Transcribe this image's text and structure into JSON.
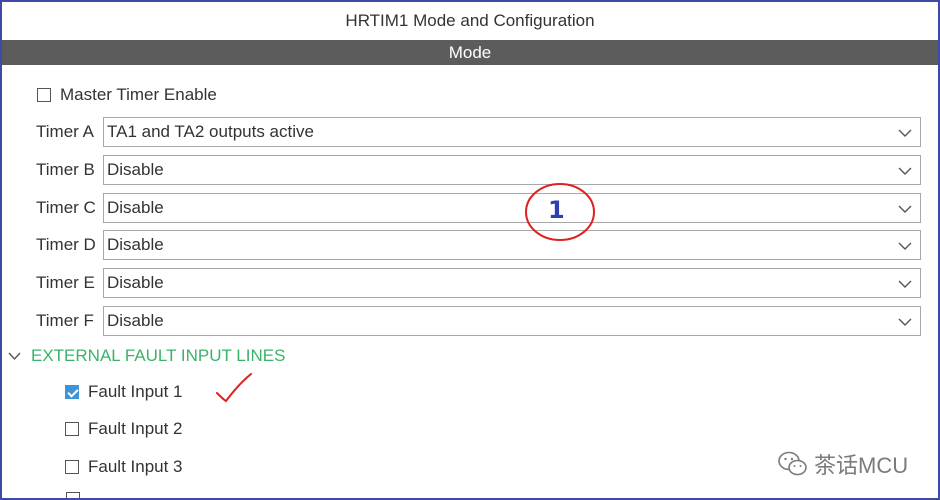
{
  "window": {
    "title": "HRTIM1 Mode and Configuration"
  },
  "mode_bar": {
    "label": "Mode"
  },
  "master_timer": {
    "label": "Master Timer Enable",
    "checked": false
  },
  "timers": [
    {
      "label": "Timer A",
      "value": "TA1 and TA2 outputs active"
    },
    {
      "label": "Timer B",
      "value": "Disable"
    },
    {
      "label": "Timer C",
      "value": "Disable"
    },
    {
      "label": "Timer D",
      "value": "Disable"
    },
    {
      "label": "Timer E",
      "value": "Disable"
    },
    {
      "label": "Timer F",
      "value": "Disable"
    }
  ],
  "section": {
    "label": "EXTERNAL FAULT INPUT LINES",
    "expanded": true,
    "color": "#3ab36a"
  },
  "fault_inputs": [
    {
      "label": "Fault Input 1",
      "checked": true
    },
    {
      "label": "Fault Input 2",
      "checked": false
    },
    {
      "label": "Fault Input 3",
      "checked": false
    }
  ],
  "annotations": {
    "circle_number": "1",
    "circle_color": "#e02020",
    "number_color": "#2f3fb3",
    "tick_color": "#e02020"
  },
  "watermark": {
    "text": "茶话MCU",
    "icon": "wechat-icon"
  },
  "colors": {
    "frame_border": "#3e4aa6",
    "mode_bar_bg": "#5c5c5c",
    "checkbox_checked": "#3d94d9"
  }
}
